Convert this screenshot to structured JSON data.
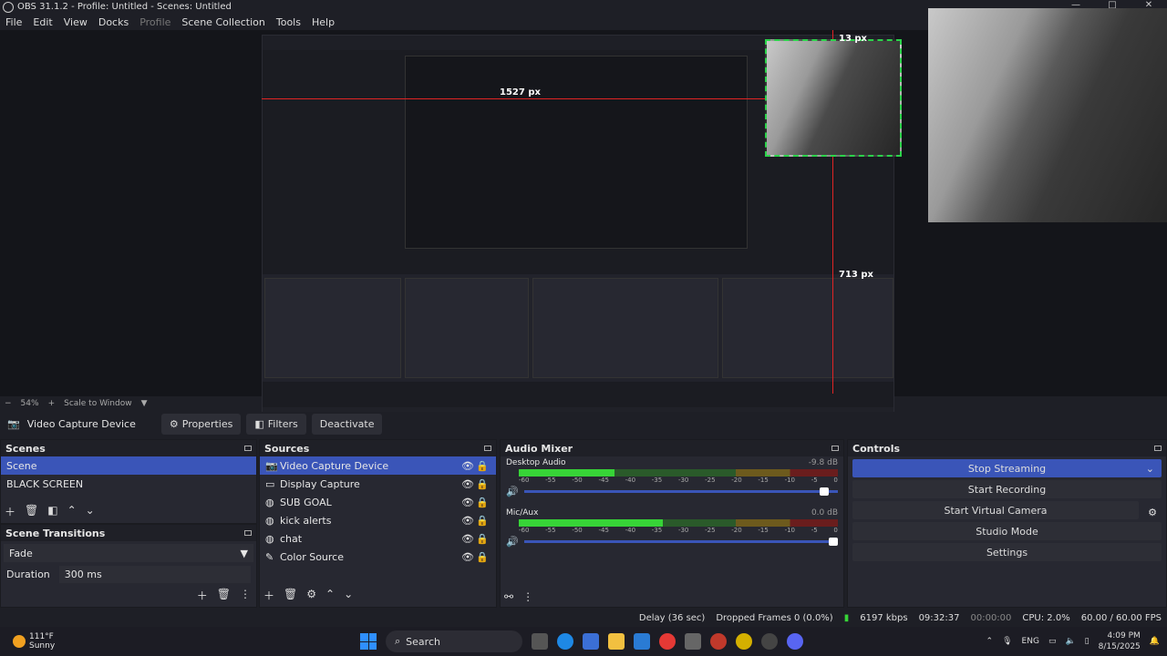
{
  "window": {
    "title": "OBS 31.1.2 - Profile: Untitled - Scenes: Untitled",
    "controls": [
      "—",
      "□",
      "✕"
    ]
  },
  "menu": [
    "File",
    "Edit",
    "View",
    "Docks",
    "Profile",
    "Scene Collection",
    "Tools",
    "Help"
  ],
  "preview": {
    "measure_top": "13 px",
    "measure_left": "1527 px",
    "measure_bottom": "713 px"
  },
  "zoom": {
    "minus": "−",
    "level": "54%",
    "plus": "+",
    "mode": "Scale to Window"
  },
  "source_toolbar": {
    "current_source": "Video Capture Device",
    "properties": "Properties",
    "filters": "Filters",
    "deactivate": "Deactivate"
  },
  "scenes": {
    "title": "Scenes",
    "items": [
      "Scene",
      "BLACK SCREEN"
    ]
  },
  "transitions": {
    "title": "Scene Transitions",
    "selected": "Fade",
    "duration_label": "Duration",
    "duration_value": "300 ms"
  },
  "sources": {
    "title": "Sources",
    "items": [
      {
        "label": "Video Capture Device",
        "icon": "camera-icon"
      },
      {
        "label": "Display Capture",
        "icon": "monitor-icon"
      },
      {
        "label": "SUB GOAL",
        "icon": "globe-icon"
      },
      {
        "label": "kick alerts",
        "icon": "globe-icon"
      },
      {
        "label": "chat",
        "icon": "globe-icon"
      },
      {
        "label": "Color Source",
        "icon": "brush-icon"
      }
    ]
  },
  "mixer": {
    "title": "Audio Mixer",
    "channels": [
      {
        "name": "Desktop Audio",
        "db": "-9.8 dB",
        "level": 0.3,
        "volume": 0.97
      },
      {
        "name": "Mic/Aux",
        "db": "0.0 dB",
        "level": 0.45,
        "volume": 1.0
      }
    ],
    "scale": [
      "-60",
      "-55",
      "-50",
      "-45",
      "-40",
      "-35",
      "-30",
      "-25",
      "-20",
      "-15",
      "-10",
      "-5",
      "0"
    ]
  },
  "controls": {
    "title": "Controls",
    "stop_streaming": "Stop Streaming",
    "start_recording": "Start Recording",
    "start_virtual_camera": "Start Virtual Camera",
    "studio_mode": "Studio Mode",
    "settings": "Settings"
  },
  "status": {
    "delay": "Delay (36 sec)",
    "dropped": "Dropped Frames 0 (0.0%)",
    "bitrate": "6197 kbps",
    "stream_time": "09:32:37",
    "rec_time": "00:00:00",
    "cpu": "CPU: 2.0%",
    "fps": "60.00 / 60.00 FPS"
  },
  "taskbar": {
    "temp": "111°F",
    "weather": "Sunny",
    "search": "Search",
    "lang": "ENG",
    "time": "4:09 PM",
    "date": "8/15/2025"
  },
  "colors": {
    "accent": "#3a55b8",
    "meter_green": "#37d437",
    "measure": "#e02424"
  }
}
